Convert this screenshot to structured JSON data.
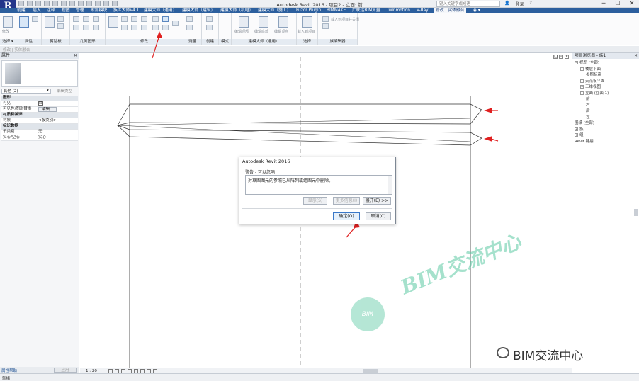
{
  "window": {
    "app_title": "Autodesk Revit 2016 -",
    "doc_title": "项目2 - 立面: 前",
    "search_placeholder": "键入关键字或短语",
    "signin": "登录",
    "logo": "R",
    "controls": [
      "─",
      "☐",
      "✕"
    ]
  },
  "ribbon_tabs": [
    {
      "label": "创建",
      "active": false
    },
    {
      "label": "插入",
      "active": false
    },
    {
      "label": "注释",
      "active": false
    },
    {
      "label": "视图",
      "active": false
    },
    {
      "label": "管理",
      "active": false
    },
    {
      "label": "附加模块",
      "active": false
    },
    {
      "label": "族库大师V4.1",
      "active": false
    },
    {
      "label": "建模大师（通用）",
      "active": false
    },
    {
      "label": "建模大师（建筑）",
      "active": false
    },
    {
      "label": "建模大师（机电）",
      "active": false
    },
    {
      "label": "建模大师（施工）",
      "active": false
    },
    {
      "label": "Fuzor Plugin",
      "active": false
    },
    {
      "label": "BIMMAKE",
      "active": false
    },
    {
      "label": "广联达BIM算量",
      "active": false
    },
    {
      "label": "Twinmotion",
      "active": false
    },
    {
      "label": "V-Ray",
      "active": false
    },
    {
      "label": "修改 | 实体融合",
      "active": true
    }
  ],
  "ribbon_groups": [
    "选择 ▾",
    "属性",
    "剪贴板",
    "几何图形",
    "修改",
    "测量",
    "创建",
    "模式",
    "建模大师（通用）",
    "选择",
    "族编辑器"
  ],
  "ribbon_texts": {
    "modify_label": "修改",
    "edit_top": "编辑顶部",
    "edit_bottom": "编辑底部",
    "edit_vertices": "编辑顶点",
    "load_to_project": "载入到项目",
    "load_to_project_close": "载入到项目并关闭"
  },
  "options_bar": {
    "text": "修改 | 实体融合"
  },
  "properties": {
    "title": "属性",
    "selector": "其他 (2)",
    "edit_type": "编辑类型",
    "rows": [
      {
        "type": "section",
        "key": "图形",
        "value": ""
      },
      {
        "type": "check",
        "key": "可见",
        "value": "☑"
      },
      {
        "type": "button",
        "key": "可见性/图形替换",
        "value": "编辑..."
      },
      {
        "type": "section",
        "key": "材质和装饰",
        "value": ""
      },
      {
        "type": "row",
        "key": "材质",
        "value": "<按类别>"
      },
      {
        "type": "section",
        "key": "标识数据",
        "value": ""
      },
      {
        "type": "row",
        "key": "子类别",
        "value": "无"
      },
      {
        "type": "row",
        "key": "实心/空心",
        "value": "实心"
      }
    ],
    "help": "属性帮助",
    "apply": "应用"
  },
  "dialog": {
    "title": "Autodesk Revit 2016",
    "warn_label": "警告 - 可以忽略",
    "message": "对草图图元的参照已从阵列或组图元中删除。",
    "btn_show": "显示(S)",
    "btn_more": "更多信息(I)",
    "btn_expand": "展开(E) >>",
    "btn_ok": "确定(O)",
    "btn_cancel": "取消(C)"
  },
  "browser": {
    "title": "项目浏览器 - 族1",
    "items": [
      {
        "label": "视图 (全部)",
        "toggle": "−",
        "level": 0
      },
      {
        "label": "楼层平面",
        "toggle": "−",
        "level": 1
      },
      {
        "label": "参照标高",
        "toggle": "",
        "level": 2
      },
      {
        "label": "天花板平面",
        "toggle": "+",
        "level": 1
      },
      {
        "label": "三维视图",
        "toggle": "+",
        "level": 1
      },
      {
        "label": "立面 (立面 1)",
        "toggle": "−",
        "level": 1
      },
      {
        "label": "前",
        "toggle": "",
        "level": 2
      },
      {
        "label": "右",
        "toggle": "",
        "level": 2
      },
      {
        "label": "后",
        "toggle": "",
        "level": 2
      },
      {
        "label": "左",
        "toggle": "",
        "level": 2
      },
      {
        "label": "图纸 (全部)",
        "toggle": "",
        "level": 0
      },
      {
        "label": "族",
        "toggle": "+",
        "level": 0
      },
      {
        "label": "组",
        "toggle": "+",
        "level": 0
      },
      {
        "label": "Revit 链接",
        "toggle": "",
        "level": 0
      }
    ]
  },
  "viewbar": {
    "scale": "1 : 20"
  },
  "status": {
    "text": "就绪"
  },
  "watermark": {
    "brand": "BIM交流中心",
    "circle": "BIM",
    "corner": "BIM交流中心"
  },
  "colors": {
    "accent": "#2c5f9e",
    "annotation_red": "#e02020",
    "watermark_green": "#5cc9a3"
  }
}
